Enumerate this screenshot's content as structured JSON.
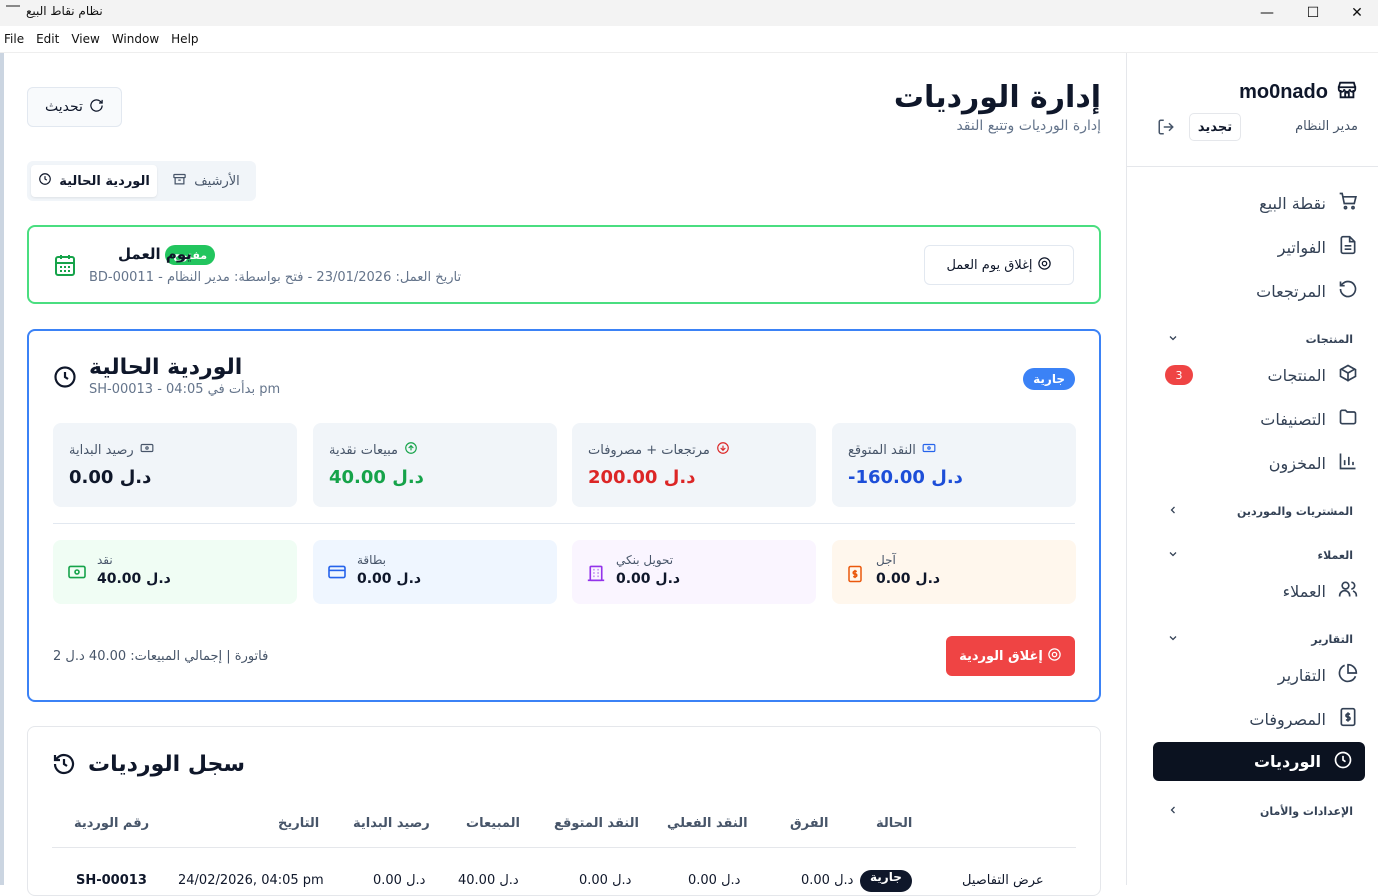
{
  "window": {
    "title": "نظام نقاط البيع",
    "minimize": "—",
    "maximize": "☐",
    "close": "✕"
  },
  "menu": [
    "File",
    "Edit",
    "View",
    "Window",
    "Help"
  ],
  "sidebar": {
    "brand": "mo0nado",
    "role": "مدير النظام",
    "renew_label": "تجديد",
    "items": [
      {
        "label": "نقطة البيع",
        "icon": "cart-icon"
      },
      {
        "label": "الفواتير",
        "icon": "file-icon"
      },
      {
        "label": "المرتجعات",
        "icon": "undo-icon"
      },
      {
        "label": "المنتجات",
        "icon": "box-icon",
        "badge": "3"
      },
      {
        "label": "التصنيفات",
        "icon": "folder-icon"
      },
      {
        "label": "المخزون",
        "icon": "bar-chart-icon"
      },
      {
        "label": "العملاء",
        "icon": "users-icon"
      },
      {
        "label": "التقارير",
        "icon": "pie-chart-icon"
      },
      {
        "label": "المصروفات",
        "icon": "dollar-icon"
      },
      {
        "label": "الورديات",
        "icon": "clock-icon",
        "active": true
      }
    ],
    "groups": {
      "products": "المنتجات",
      "purchases": "المشتريات والموردين",
      "customers": "العملاء",
      "reports": "التقارير",
      "settings": "الإعدادات والأمان"
    }
  },
  "header": {
    "title": "إدارة الورديات",
    "subtitle": "إدارة الورديات وتتبع النقد",
    "refresh_label": "تحديث"
  },
  "tabs": {
    "current": "الوردية الحالية",
    "archive": "الأرشيف"
  },
  "workday": {
    "title": "يوم العمل",
    "status": "مفتوح",
    "meta": "تاريخ العمل: 23/01/2026 - فتح بواسطة: مدير النظام - BD-00011",
    "close_label": "إغلاق يوم العمل"
  },
  "shift": {
    "title": "الوردية الحالية",
    "meta": "SH-00013 - بدأت في 04:05 pm",
    "status": "جارية",
    "stats": [
      {
        "label": "النقد المتوقع",
        "value": "-160.00 د.ل",
        "color": "#1d4ed8"
      },
      {
        "label": "مرتجعات + مصروفات",
        "value": "200.00 د.ل",
        "color": "#dc2626"
      },
      {
        "label": "مبيعات نقدية",
        "value": "40.00 د.ل",
        "color": "#16a34a"
      },
      {
        "label": "رصيد البداية",
        "value": "0.00 د.ل",
        "color": "#0f172a"
      }
    ],
    "payments": [
      {
        "label": "آجل",
        "value": "0.00 د.ل",
        "bg": "#fff7ed"
      },
      {
        "label": "تحويل بنكي",
        "value": "0.00 د.ل",
        "bg": "#faf5ff"
      },
      {
        "label": "بطاقة",
        "value": "0.00 د.ل",
        "bg": "#eff6ff"
      },
      {
        "label": "نقد",
        "value": "40.00 د.ل",
        "bg": "#f0fdf4"
      }
    ],
    "summary": "فاتورة | إجمالي المبيعات: 40.00 د.ل 2",
    "close_label": "إغلاق الوردية"
  },
  "log": {
    "title": "سجل الورديات",
    "columns": [
      "رقم الوردية",
      "التاريخ",
      "رصيد البداية",
      "المبيعات",
      "النقد المتوقع",
      "النقد الفعلي",
      "الفرق",
      "الحالة"
    ],
    "row": {
      "id": "SH-00013",
      "date": "24/02/2026, 04:05 pm",
      "start": "0.00 د.ل",
      "sales": "40.00 د.ل",
      "expected": "0.00 د.ل",
      "actual": "0.00 د.ل",
      "diff": "0.00 د.ل",
      "status": "جارية",
      "action": "عرض التفاصيل"
    }
  }
}
